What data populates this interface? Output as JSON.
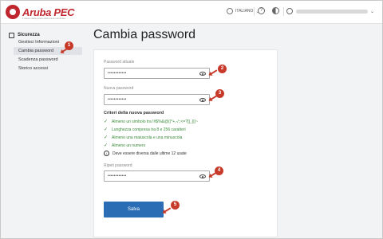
{
  "header": {
    "logo_text": "Aruba PEC",
    "logo_tagline": "il valore della posta elettronica certificata",
    "language": "ITALIANO",
    "help_icon": "question-circle-icon",
    "theme_icon": "contrast-icon"
  },
  "sidebar": {
    "section_title": "Sicurezza",
    "items": [
      {
        "label": "Gestisci Informazioni"
      },
      {
        "label": "Cambia password"
      },
      {
        "label": "Scadenza password"
      },
      {
        "label": "Storico accessi"
      }
    ]
  },
  "main": {
    "title": "Cambia password",
    "current_password_label": "Password attuale",
    "current_password_value": "••••••••••••",
    "new_password_label": "Nuova password",
    "new_password_value": "••••••••••••",
    "criteria_title": "Criteri della nuova password",
    "criteria": [
      {
        "text": "Almeno un simbolo tra !#$%&@()*+,-/:;<=?[]_{|}~",
        "status": "ok"
      },
      {
        "text": "Lunghezza compresa tra 8 e 256 caratteri",
        "status": "ok"
      },
      {
        "text": "Almeno una maiuscola e una minuscola",
        "status": "ok"
      },
      {
        "text": "Almeno un numero",
        "status": "ok"
      },
      {
        "text": "Deve essere diversa dalle ultime 12 usate",
        "status": "info"
      }
    ],
    "repeat_password_label": "Ripeti password",
    "repeat_password_value": "••••••••••••",
    "save_label": "Salva"
  },
  "annotations": [
    "1",
    "2",
    "3",
    "4",
    "5"
  ],
  "colors": {
    "accent": "#2a6db5",
    "brand": "#c0262d",
    "marker": "#c73a2a",
    "ok": "#3a8a3a"
  }
}
